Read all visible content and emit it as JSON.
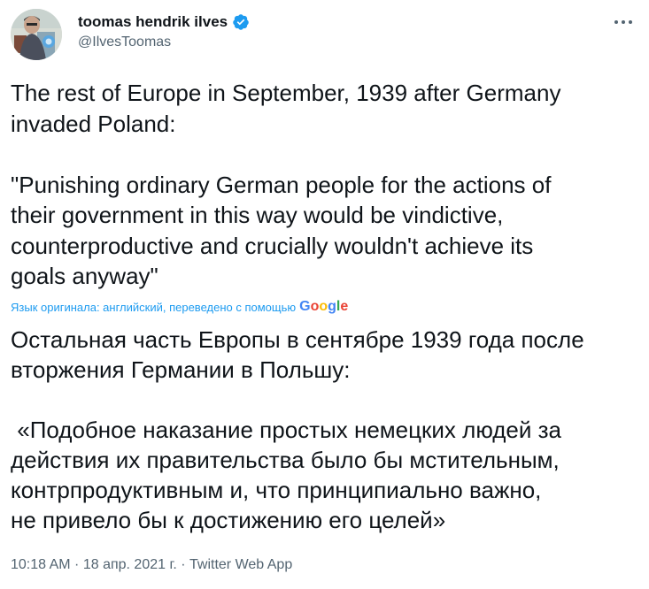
{
  "author": {
    "display_name": "toomas hendrik ilves",
    "handle": "@IlvesToomas",
    "verified": true,
    "avatar_icon": "profile-photo"
  },
  "menu": {
    "icon": "more-dots-icon"
  },
  "tweet": {
    "text": "The rest of Europe in September, 1939 after Germany\ninvaded Poland:\n\n\"Punishing ordinary German people for the actions of\ntheir government in this way would be vindictive,\ncounterproductive and crucially wouldn't achieve its\ngoals anyway\""
  },
  "translation": {
    "note": "Язык оригинала: английский, переведено с помощью",
    "provider": "Google",
    "text": "Остальная часть Европы в сентябре 1939 года после\nвторжения Германии в Польшу:\n\n «Подобное наказание простых немецких людей за\nдействия их правительства было бы мстительным,\nконтрпродуктивным и, что принципиально важно,\nне привело бы к достижению его целей»"
  },
  "meta": {
    "time": "10:18 AM",
    "date": "18 апр. 2021 г.",
    "source": "Twitter Web App",
    "separator": " · "
  },
  "colors": {
    "accent": "#1d9bf0",
    "text": "#0f1419",
    "secondary": "#536471"
  }
}
